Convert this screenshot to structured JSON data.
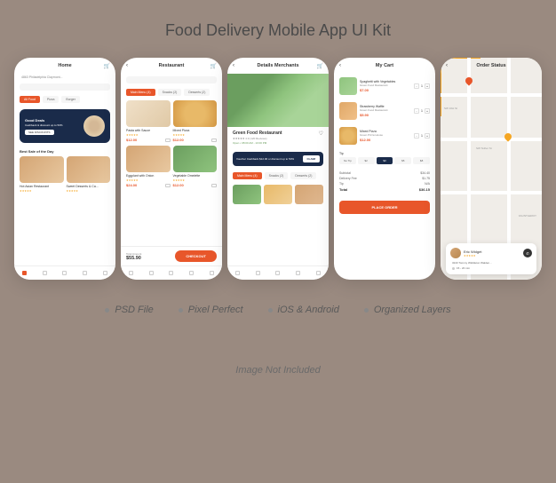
{
  "page_title": "Food Delivery Mobile App UI Kit",
  "features": [
    "PSD File",
    "Pixel Perfect",
    "iOS & Android",
    "Organized Layers"
  ],
  "footer_note": "Image Not Included",
  "colors": {
    "accent": "#e8562a",
    "dark": "#1a2b4a",
    "star": "#f5a623"
  },
  "screens": {
    "home": {
      "title": "Home",
      "address": "4863 Philadelphia Claymont...",
      "chips": [
        {
          "label": "All Food",
          "active": true
        },
        {
          "label": "Pizza",
          "active": false
        },
        {
          "label": "Burger",
          "active": false
        }
      ],
      "deal": {
        "title": "Good Deals",
        "subtitle": "Cashback & discount up to 50%",
        "button": "SEE DISCOUNTS"
      },
      "section": "Best Sale of the Day",
      "cards": [
        {
          "name": "Hot Asian Restaurant",
          "stars": "★★★★★"
        },
        {
          "name": "Sweet Desserts & Ca...",
          "stars": "★★★★★"
        }
      ]
    },
    "restaurant": {
      "title": "Restaurant",
      "chips": [
        {
          "label": "Main Menu (4)",
          "active": true
        },
        {
          "label": "Snacks (2)",
          "active": false
        },
        {
          "label": "Desserts (2)",
          "active": false
        }
      ],
      "items": [
        {
          "name": "Pasta with Sauce",
          "price": "$12.00"
        },
        {
          "name": "Mixed Pizza",
          "price": "$12.00"
        },
        {
          "name": "Eggplant with Onion",
          "price": "$24.00"
        },
        {
          "name": "Vegetable Omelette",
          "price": "$12.00"
        }
      ],
      "total_label": "Total Amount",
      "total": "$55.90",
      "checkout": "CHECKOUT"
    },
    "details": {
      "title": "Details Merchants",
      "name": "Green Food Restaurant",
      "rating": "★★★★★  4.9 (120 Reviews)",
      "status": "Open • 08:00 AM - 10:00 PM",
      "voucher": {
        "text": "Voucher  Cashback $12.00 or discount up to 50%",
        "button": "CLAIM"
      },
      "chips": [
        {
          "label": "Main Menu (4)",
          "active": true
        },
        {
          "label": "Snacks (2)",
          "active": false
        },
        {
          "label": "Desserts (2)",
          "active": false
        }
      ]
    },
    "cart": {
      "title": "My Cart",
      "items": [
        {
          "name": "Spaghetti with Vegetables",
          "sub": "Green Food Restaurant",
          "price": "$7.00",
          "qty": 1
        },
        {
          "name": "Strawberry Waffle",
          "sub": "Green Food Restaurant",
          "price": "$5.90",
          "qty": 1
        },
        {
          "name": "Mixed Pizza",
          "sub": "Green Pizza House",
          "price": "$12.00",
          "qty": 1
        }
      ],
      "tip": {
        "label": "Tip",
        "options": [
          "No Tip",
          "$2",
          "$3",
          "$5",
          "$8"
        ],
        "active_index": 2
      },
      "summary": [
        {
          "label": "Subtotal",
          "value": "$34.40"
        },
        {
          "label": "Delivery Fee",
          "value": "$1.75"
        },
        {
          "label": "Tip",
          "value": "N/A"
        }
      ],
      "total_label": "Total",
      "total": "$36.15",
      "button": "PLACE ORDER"
    },
    "order": {
      "title": "Order Status",
      "map_labels": [
        "SW 10st St",
        "SW Tether St",
        "FAUNTLEROY"
      ],
      "driver": {
        "name": "Eric Widget",
        "stars": "★★★★★",
        "address": "3243 Tommy Widdleton Walden...",
        "eta": "15 - 20 min"
      }
    }
  }
}
